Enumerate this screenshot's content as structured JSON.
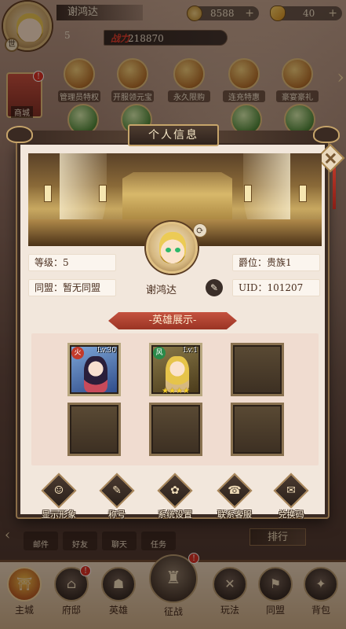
{
  "topbar": {
    "player_name": "谢鸿达",
    "level": "5",
    "power_label": "战力",
    "power_value": "218870",
    "badge": "世",
    "currency1": "8588",
    "currency2": "40",
    "plus": "+"
  },
  "features": [
    {
      "label": "管理员特权",
      "icon": "admin-privilege-icon"
    },
    {
      "label": "开服领元宝",
      "icon": "gift-ingot-icon"
    },
    {
      "label": "永久限购",
      "icon": "treasure-chest-icon"
    },
    {
      "label": "连充特惠",
      "icon": "recharge-deal-icon"
    },
    {
      "label": "豪宴豪礼",
      "icon": "feast-gift-icon"
    }
  ],
  "side": {
    "label": "商城",
    "badge": "!"
  },
  "dialog": {
    "title": "个人信息",
    "level_label": "等级：5",
    "alliance_label": "同盟：暂无同盟",
    "rank_label": "爵位：贵族1",
    "uid_label": "UID：101207",
    "player_name": "谢鸿达",
    "section_title": "-英雄展示-",
    "heroes": [
      {
        "level": "Lv.30",
        "element": "火",
        "stars": ""
      },
      {
        "level": "Lv.1",
        "element": "风",
        "stars": "★★★★"
      }
    ],
    "buttons": [
      {
        "label": "显示形象",
        "icon": "appearance-icon",
        "glyph": "☺"
      },
      {
        "label": "称号",
        "icon": "title-scroll-icon",
        "glyph": "✎"
      },
      {
        "label": "系统设置",
        "icon": "settings-icon",
        "glyph": "✿"
      },
      {
        "label": "联系客服",
        "icon": "customer-service-icon",
        "glyph": "☎"
      },
      {
        "label": "兑换码",
        "icon": "redeem-code-icon",
        "glyph": "✉"
      }
    ]
  },
  "below": {
    "tabs": [
      "邮件",
      "好友",
      "聊天",
      "任务"
    ],
    "rank_button": "排行",
    "left_arrow": "‹"
  },
  "bottom_nav": [
    {
      "label": "主城",
      "glyph": "⛩"
    },
    {
      "label": "府邸",
      "glyph": "⌂",
      "badge": "!"
    },
    {
      "label": "英雄",
      "glyph": "☗"
    },
    {
      "label": "征战",
      "glyph": "♜",
      "badge": "!"
    },
    {
      "label": "玩法",
      "glyph": "✕"
    },
    {
      "label": "同盟",
      "glyph": "⚑"
    },
    {
      "label": "背包",
      "glyph": "✦"
    }
  ],
  "colors": {
    "accent_red": "#c5523f",
    "dialog_bg": "#f2e7dc",
    "frame_dark": "#3a2a22",
    "gold": "#e0c184"
  }
}
